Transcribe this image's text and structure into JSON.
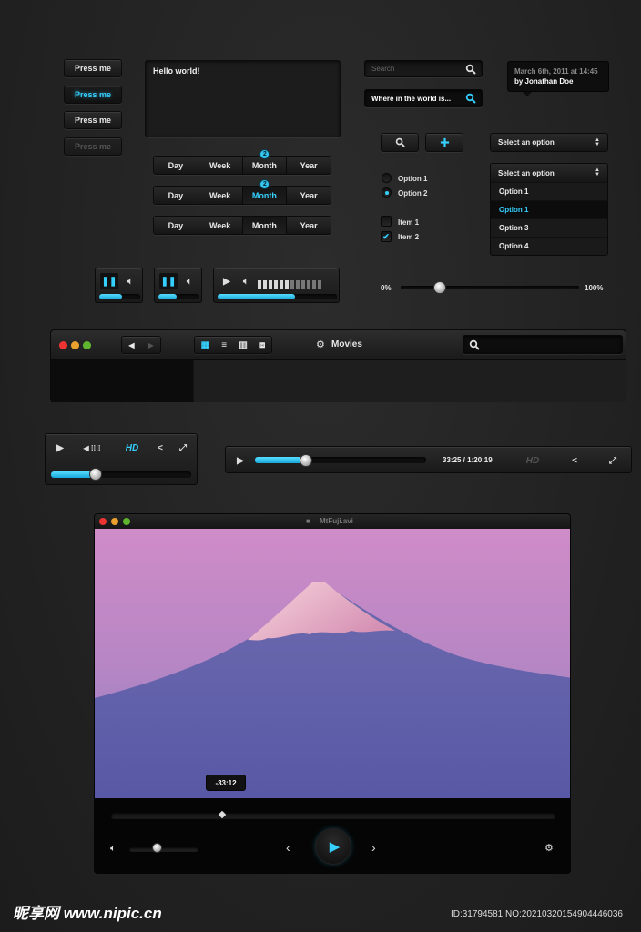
{
  "buttons": {
    "press1": "Press me",
    "press2": "Press me",
    "press3": "Press me",
    "press4": "Press me"
  },
  "textarea": {
    "value": "Hello world!"
  },
  "segments": {
    "row1": [
      "Day",
      "Week",
      "Month",
      "Year"
    ],
    "row2": [
      "Day",
      "Week",
      "Month",
      "Year"
    ],
    "row3": [
      "Day",
      "Week",
      "Month",
      "Year"
    ],
    "badge1": "2",
    "badge2": "2"
  },
  "search": {
    "placeholder": "Search",
    "filled_value": "Where in the world is..."
  },
  "tooltip": {
    "meta": "March 6th, 2011 at 14:45",
    "author": "by Jonathan Doe"
  },
  "select": {
    "closed_label": "Select an option",
    "open_label": "Select an option",
    "options": [
      "Option 1",
      "Option 1",
      "Option 3",
      "Option 4"
    ],
    "selected_index": 1
  },
  "radios": [
    "Option 1",
    "Option 2"
  ],
  "checkboxes": [
    "Item 1",
    "Item 2"
  ],
  "slider": {
    "min_label": "0%",
    "max_label": "100%",
    "value": 0.22
  },
  "players": {
    "small1_progress": 0.55,
    "small2_progress": 0.45,
    "medium_progress": 0.65,
    "hd_label": "HD",
    "hd_progress": 0.32,
    "wide_time": "33:25 / 1:20:19",
    "wide_hd": "HD",
    "wide_progress": 0.3
  },
  "finder": {
    "title": "Movies"
  },
  "video": {
    "filename": "MtFuji.avi",
    "time_tooltip": "-33:12",
    "scrub_position": 0.25,
    "volume": 0.4,
    "colors": {
      "sky_top": "#c88bc8",
      "sky_bottom": "#9a7ec4",
      "mountain": "#5e5ea8",
      "snow": "#f2c4d4"
    }
  },
  "footer": {
    "watermark": "昵享网 www.nipic.cn",
    "id": "ID:31794581 NO:20210320154904446036"
  }
}
